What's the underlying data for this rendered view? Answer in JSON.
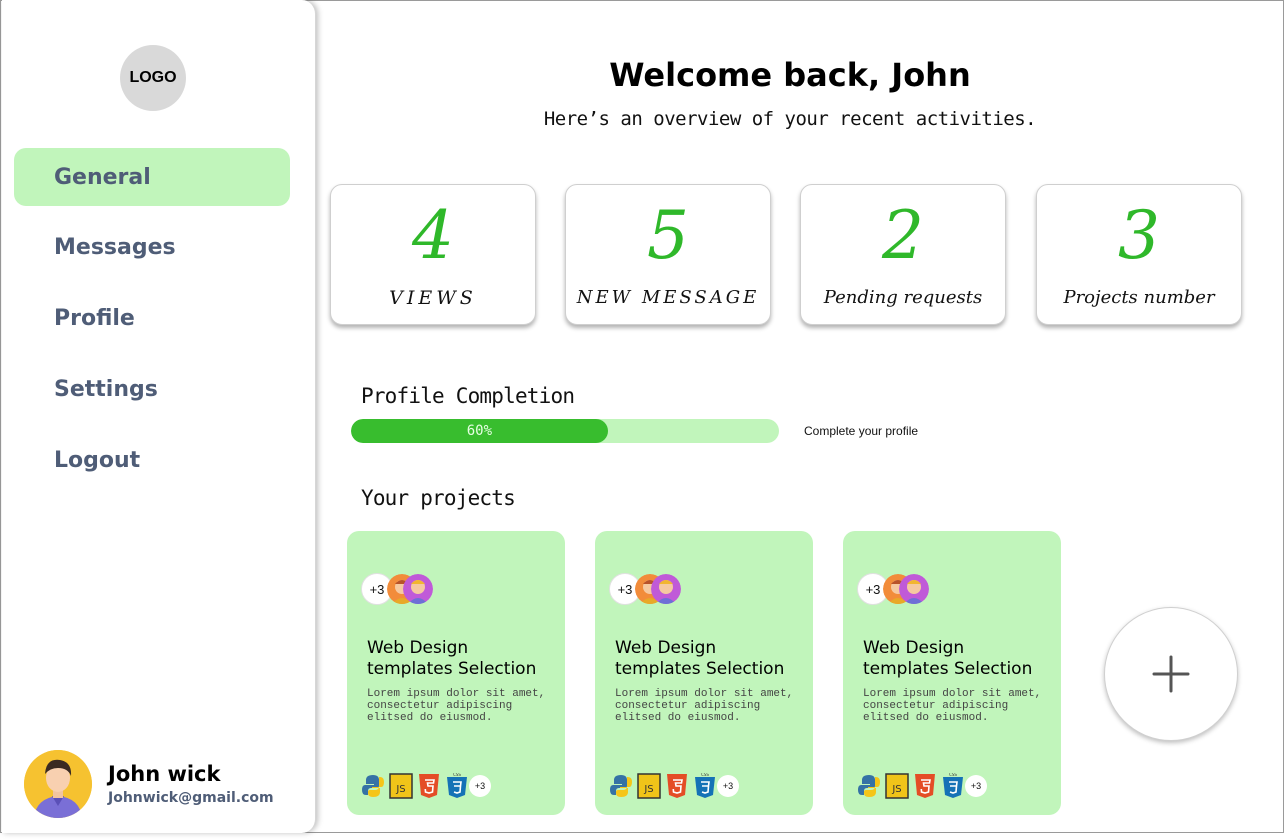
{
  "sidebar": {
    "logo": "LOGO",
    "items": [
      {
        "label": "General",
        "active": true
      },
      {
        "label": "Messages"
      },
      {
        "label": "Profile"
      },
      {
        "label": "Settings"
      },
      {
        "label": "Logout"
      }
    ],
    "user": {
      "name": "John wick",
      "email": "Johnwick@gmail.com"
    }
  },
  "header": {
    "title": "Welcome back, John",
    "subtitle": "Here’s an overview of your recent activities."
  },
  "stats": [
    {
      "value": "4",
      "label": "VIEWS"
    },
    {
      "value": "5",
      "label": "NEW MESSAGE"
    },
    {
      "value": "2",
      "label": "Pending requests"
    },
    {
      "value": "3",
      "label": "Projects number"
    }
  ],
  "profile_completion": {
    "title": "Profile Completion",
    "percent": 60,
    "percent_label": "60%",
    "link": "Complete your profile"
  },
  "projects": {
    "title": "Your projects",
    "items": [
      {
        "members_more": "+3",
        "title": "Web Design templates Selection",
        "description": "Lorem ipsum dolor sit amet, consectetur adipiscing elitsed do eiusmod.",
        "tech_icons": [
          "python-icon",
          "javascript-icon",
          "html5-icon",
          "css3-icon"
        ],
        "tech_more": "+3"
      },
      {
        "members_more": "+3",
        "title": "Web Design templates Selection",
        "description": "Lorem ipsum dolor sit amet, consectetur adipiscing elitsed do eiusmod.",
        "tech_icons": [
          "python-icon",
          "javascript-icon",
          "html5-icon",
          "css3-icon"
        ],
        "tech_more": "+3"
      },
      {
        "members_more": "+3",
        "title": "Web Design templates Selection",
        "description": "Lorem ipsum dolor sit amet, consectetur adipiscing elitsed do eiusmod.",
        "tech_icons": [
          "python-icon",
          "javascript-icon",
          "html5-icon",
          "css3-icon"
        ],
        "tech_more": "+3"
      }
    ],
    "add_icon": "plus-icon"
  },
  "colors": {
    "accent_green": "#38bd2e",
    "light_green": "#c1f5bb",
    "nav_text": "#4f5d77"
  }
}
